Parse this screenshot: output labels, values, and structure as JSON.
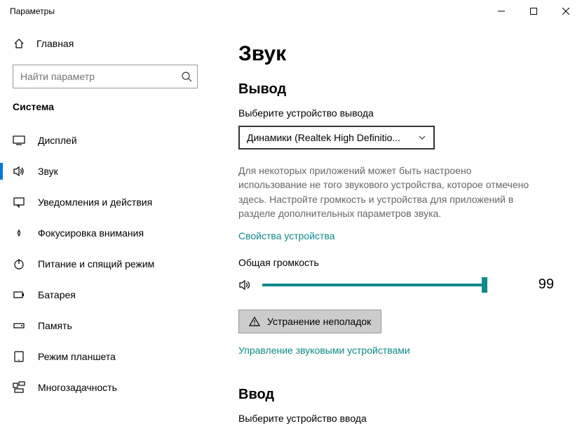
{
  "window": {
    "title": "Параметры"
  },
  "sidebar": {
    "home_label": "Главная",
    "search_placeholder": "Найти параметр",
    "section_title": "Система",
    "items": [
      {
        "label": "Дисплей",
        "icon": "display"
      },
      {
        "label": "Звук",
        "icon": "sound",
        "active": true
      },
      {
        "label": "Уведомления и действия",
        "icon": "notifications"
      },
      {
        "label": "Фокусировка внимания",
        "icon": "focus"
      },
      {
        "label": "Питание и спящий режим",
        "icon": "power"
      },
      {
        "label": "Батарея",
        "icon": "battery"
      },
      {
        "label": "Память",
        "icon": "storage"
      },
      {
        "label": "Режим планшета",
        "icon": "tablet"
      },
      {
        "label": "Многозадачность",
        "icon": "multitask"
      }
    ]
  },
  "main": {
    "page_title": "Звук",
    "output": {
      "heading": "Вывод",
      "choose_device_label": "Выберите устройство вывода",
      "selected_device": "Динамики (Realtek High Definitio...",
      "description": "Для некоторых приложений может быть настроено использование не того звукового устройства, которое отмечено здесь. Настройте громкость и устройства для приложений в разделе дополнительных параметров звука.",
      "device_props_link": "Свойства устройства",
      "master_volume_label": "Общая громкость",
      "volume_value": "99",
      "troubleshoot_label": "Устранение неполадок",
      "manage_devices_link": "Управление звуковыми устройствами"
    },
    "input": {
      "heading": "Ввод",
      "choose_device_label": "Выберите устройство ввода"
    }
  }
}
